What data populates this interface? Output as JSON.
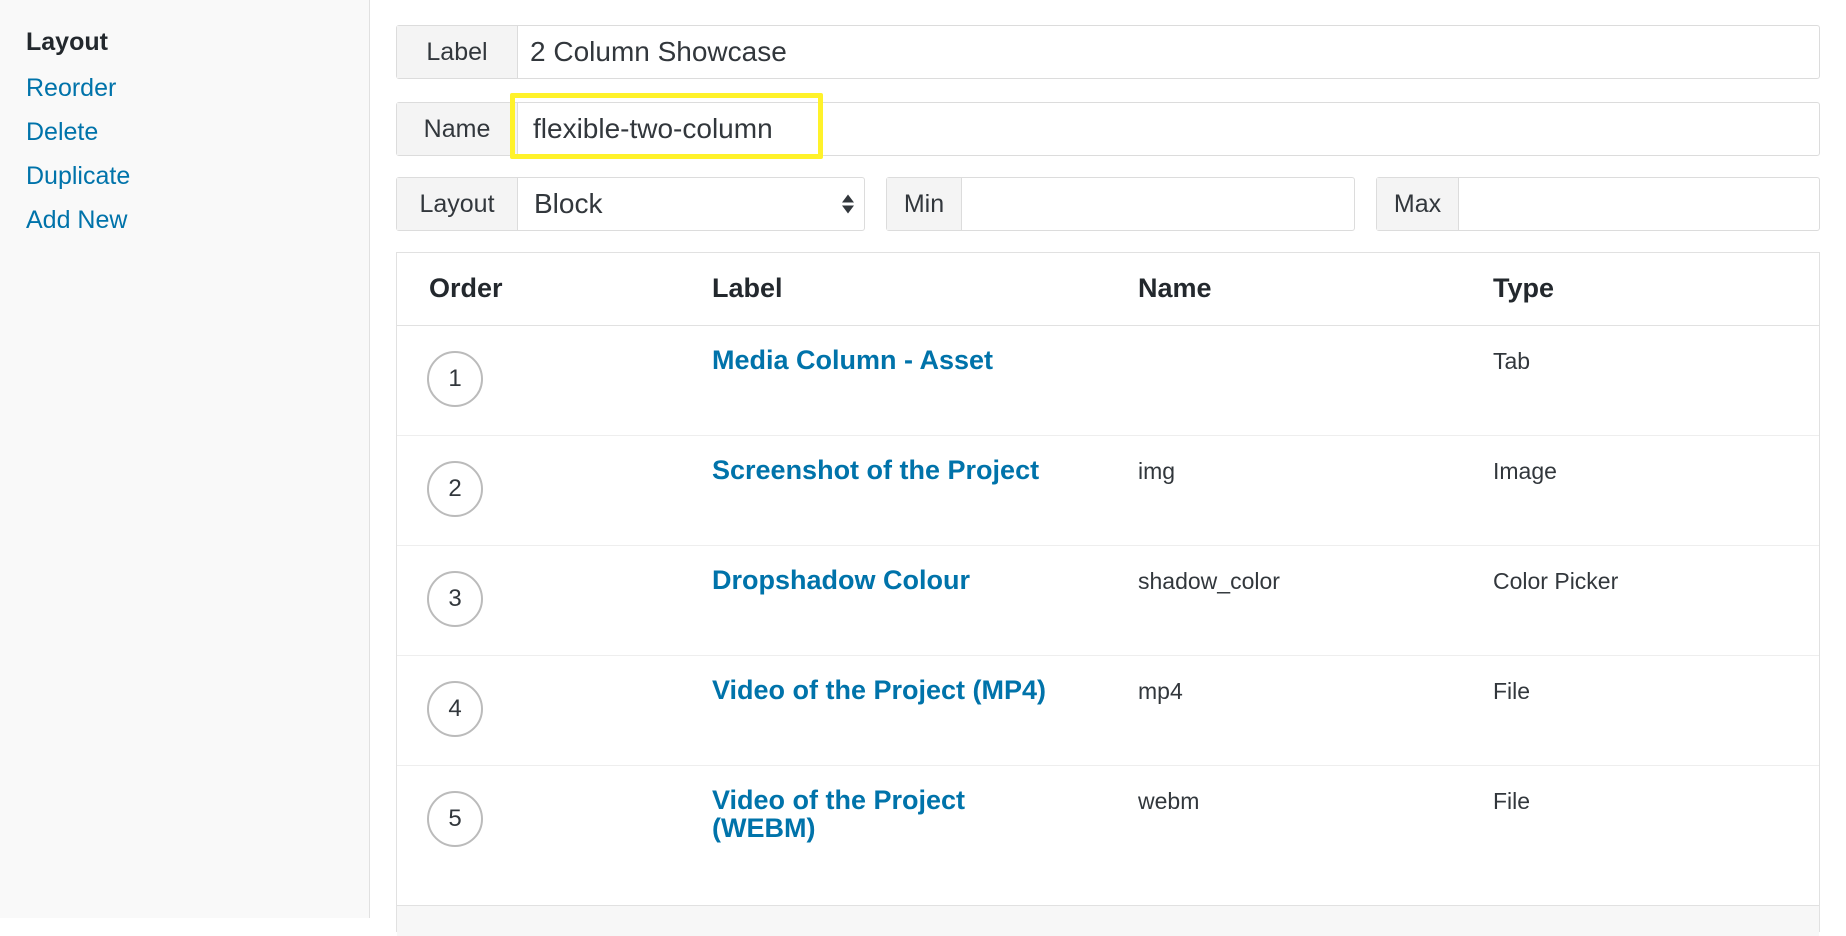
{
  "sidebar": {
    "heading": "Layout",
    "actions": [
      "Reorder",
      "Delete",
      "Duplicate",
      "Add New"
    ]
  },
  "fields": {
    "label": {
      "prepend": "Label",
      "value": "2 Column Showcase"
    },
    "name": {
      "prepend": "Name",
      "value": "flexible-two-column"
    },
    "layout": {
      "prepend": "Layout",
      "value": "Block"
    },
    "min": {
      "prepend": "Min",
      "value": ""
    },
    "max": {
      "prepend": "Max",
      "value": ""
    }
  },
  "table": {
    "headers": {
      "order": "Order",
      "label": "Label",
      "name": "Name",
      "type": "Type"
    },
    "rows": [
      {
        "order": "1",
        "label": "Media Column - Asset",
        "name": "",
        "type": "Tab"
      },
      {
        "order": "2",
        "label": "Screenshot of the Project",
        "name": "img",
        "type": "Image"
      },
      {
        "order": "3",
        "label": "Dropshadow Colour",
        "name": "shadow_color",
        "type": "Color Picker"
      },
      {
        "order": "4",
        "label": "Video of the Project (MP4)",
        "name": "mp4",
        "type": "File"
      },
      {
        "order": "5",
        "label": "Video of the Project (WEBM)",
        "name": "webm",
        "type": "File"
      }
    ]
  },
  "colors": {
    "link": "#0073aa",
    "highlight": "#fff22a"
  }
}
